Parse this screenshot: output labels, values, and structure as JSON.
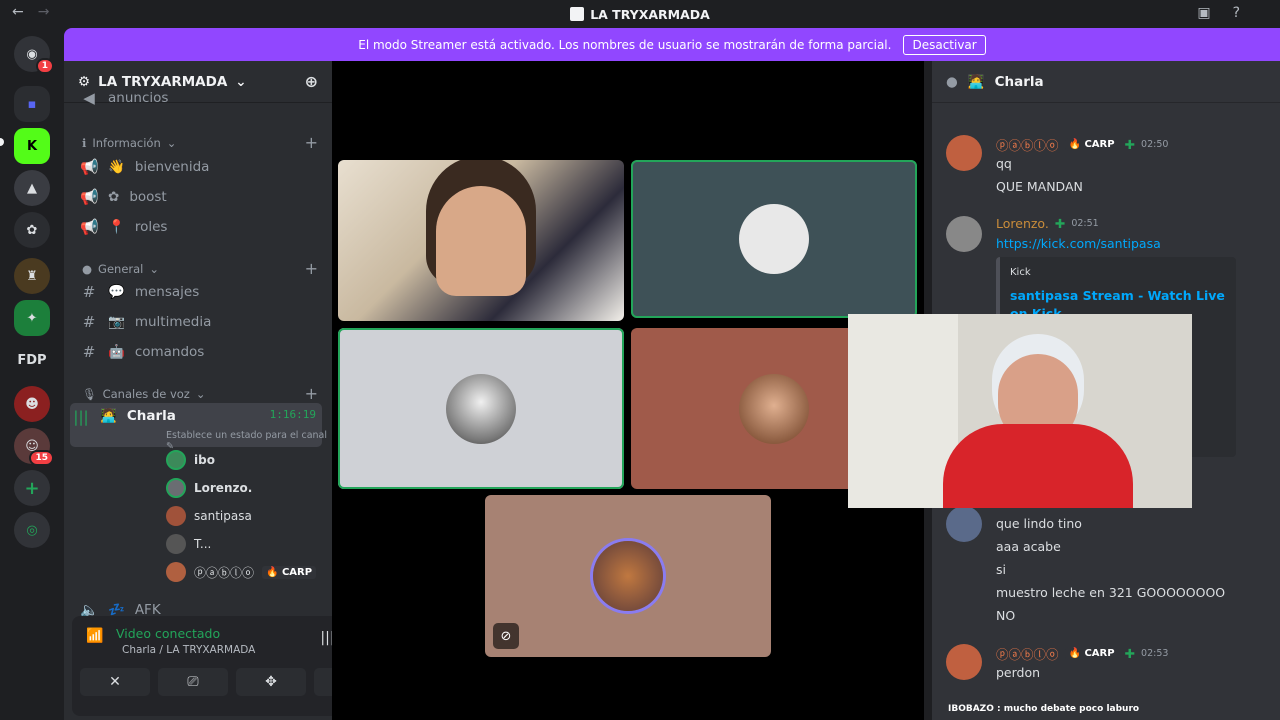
{
  "titlebar": {
    "title": "LA TRYXARMADA"
  },
  "rail": {
    "badge_home": "1",
    "fdp_label": "FDP",
    "badge_server": "15"
  },
  "banner": {
    "text": "El modo Streamer está activado. Los nombres de usuario se mostrarán de forma parcial.",
    "button": "Desactivar"
  },
  "guild": {
    "name": "LA TRYXARMADA",
    "partial_top": "anuncios"
  },
  "categories": {
    "info": "Información",
    "general": "General",
    "voice": "Canales de voz"
  },
  "channels": {
    "bienvenida": "bienvenida",
    "boost": "boost",
    "roles": "roles",
    "mensajes": "mensajes",
    "multimedia": "multimedia",
    "comandos": "comandos",
    "charla": "Charla",
    "charla_time": "1:16:19",
    "charla_status": "Establece un estado para el canal",
    "afk": "AFK"
  },
  "voice_users": [
    {
      "name": "ibo"
    },
    {
      "name": "Lorenzo."
    },
    {
      "name": "santipasa"
    },
    {
      "name": "T..."
    },
    {
      "name": "ⓟⓐⓑⓛⓞ",
      "tag": "CARP"
    }
  ],
  "voice_panel": {
    "status": "Video conectado",
    "location": "Charla / LA TRYXARMADA"
  },
  "chat": {
    "channel": "Charla",
    "messages": [
      {
        "author": "ⓟⓐⓑⓛⓞ",
        "tag": "CARP",
        "time": "02:50",
        "lines": [
          "qq",
          "QUE MANDAN"
        ]
      },
      {
        "author": "Lorenzo.",
        "time": "02:51",
        "link": "https://kick.com/santipasa",
        "embed": {
          "provider": "Kick",
          "title": "santipasa Stream - Watch Live on Kick"
        }
      },
      {
        "lines": [
          "que lindo tino",
          "aaa acabe",
          "si",
          "muestro leche en 321 GOOOOOOOO",
          "NO"
        ]
      },
      {
        "author": "ⓟⓐⓑⓛⓞ",
        "tag": "CARP",
        "time": "02:53",
        "lines": [
          "perdon"
        ]
      }
    ],
    "ticker": "IBOBAZO : mucho debate poco laburo"
  },
  "colors": {
    "accent": "#9147ff",
    "speaking": "#23a55a",
    "link": "#00a8fc"
  }
}
